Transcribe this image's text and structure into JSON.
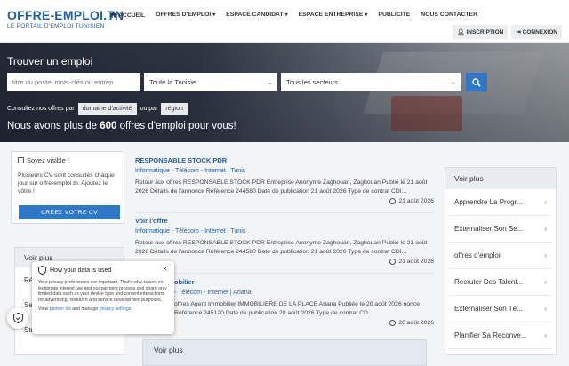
{
  "header": {
    "logo_main": "OFFRE-EMPLOI.TN",
    "logo_sub": "LE PORTAIL D'EMPLOI TUNISIEN",
    "nav": [
      {
        "label": "ACCUEIL"
      },
      {
        "label": "OFFRES D'EMPLOI"
      },
      {
        "label": "ESPACE CANDIDAT"
      },
      {
        "label": "ESPACE ENTREPRISE"
      },
      {
        "label": "PUBLICITE"
      },
      {
        "label": "NOUS CONTACTER"
      }
    ],
    "inscription": "INSCRIPTION",
    "connexion": "CONNEXION"
  },
  "hero": {
    "title": "Trouver un emploi",
    "search_placeholder": "titre du poste, mots-clés ou entrep",
    "region_value": "Toute la Tunisie",
    "sector_value": "Tous les secteurs",
    "browse_text": "Consultez nos offres par",
    "browse_domain": "domaine d'activité",
    "browse_or": "ou par",
    "browse_region": "région",
    "count_prefix": "Nous avons plus de",
    "count_value": "600",
    "count_suffix": "offres d'emploi pour vous!"
  },
  "cv_box": {
    "title": "Soyez visible !",
    "text": "Plusieurs CV sont consultés chaque jour sur offre-emploi.tn. Ajoutez le vôtre !",
    "button": "CREEZ VOTRE CV"
  },
  "left_more": {
    "title": "Voir plus",
    "items": [
      "Réc",
      "Sec",
      "Structuration Des R..."
    ]
  },
  "jobs": [
    {
      "title": "RESPONSABLE STOCK PDR",
      "category": "Informatique - Télécom - Internet | Tunis",
      "desc": "Retour aux offres RESPONSABLE STOCK PDR Entreprise Anonyme Zaghouan, Zaghouan Publié le 21 août 2026 Détails de l'annonce Référence 244580 Date de publication 21 août 2026 Type de contrat CDI...",
      "date": "21 août 2026"
    },
    {
      "title": "Voir l'offre",
      "category": "Informatique - Télécom - Internet | Tunis",
      "desc": "Retour aux offres RESPONSABLE STOCK PDR Entreprise Anonyme Zaghouan, Zaghouan Publié le 21 août 2026 Détails de l'annonce Référence 244580 Date de publication 21 août 2026 Type de contrat CDI...",
      "date": "21 août 2026"
    },
    {
      "title": "obilier",
      "category": "- Télécom - Internet | Ariana",
      "desc": "offres Agent Immobilier IMMOBILIERE DE LA PLACE Ariana Publiée le 20 août 2026 nonce Référence 245120 Date de publication 20 août 2026 Type de contrat CD",
      "date": "20 août 2026"
    }
  ],
  "mid_more": {
    "title": "Voir plus"
  },
  "right_more": {
    "title": "Voir plus",
    "items": [
      "Apprendre La Progr...",
      "Externaliser Son Se...",
      "offres d'emploi",
      "Recruter Des Talent...",
      "Externaliser Son Té...",
      "Planifier Sa Reconve..."
    ]
  },
  "privacy": {
    "title": "How your data is used",
    "text": "Your privacy preferences are important. That's why, based on legitimate interest, we and our partners process and share only limited data such as your device type and content interactions for advertising, research and service development purposes.",
    "links_prefix": "View",
    "partner_link": "partner list",
    "links_mid": "and manage",
    "settings_link": "privacy settings",
    "links_suffix": "."
  },
  "colors": {
    "brand": "#1f5fa3",
    "button": "#2e78c7"
  }
}
